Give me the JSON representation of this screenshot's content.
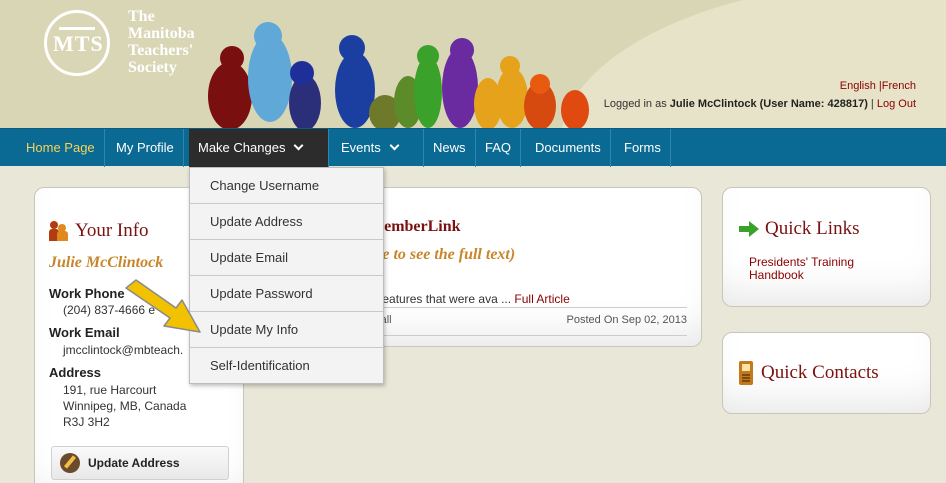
{
  "header": {
    "org_name_lines": [
      "The",
      "Manitoba",
      "Teachers'",
      "Society"
    ],
    "logo_letters": "MTS",
    "lang_english": "English",
    "lang_sep": " |",
    "lang_french": "French",
    "login_prefix": "Logged in as ",
    "login_user": "Julie McClintock (User Name: 428817)",
    "login_sep": " | ",
    "logout": "Log Out"
  },
  "nav": {
    "items": [
      {
        "label": "Home Page"
      },
      {
        "label": "My Profile"
      },
      {
        "label": "Make Changes"
      },
      {
        "label": "Events"
      },
      {
        "label": "News"
      },
      {
        "label": "FAQ"
      },
      {
        "label": "Documents"
      },
      {
        "label": "Forms"
      }
    ]
  },
  "dropdown": {
    "items": [
      "Change Username",
      "Update Address",
      "Update Email",
      "Update Password",
      "Update My Info",
      "Self-Identification"
    ]
  },
  "your_info": {
    "title": "Your Info",
    "name": "Julie McClintock",
    "work_phone_label": "Work Phone",
    "work_phone_value": "(204) 837-4666 e",
    "work_email_label": "Work Email",
    "work_email_value": "jmcclintock@mbteach.",
    "address_label": "Address",
    "address_line1": "191, rue Harcourt",
    "address_line2": "Winnipeg, MB, Canada",
    "address_line3": "R3J 3H2",
    "update_address_button": "Update Address"
  },
  "memberlink": {
    "title": "MemberLink",
    "subtitle": "itle to see the full text)",
    "text": "e features that were ava ... ",
    "full_article": "Full Article",
    "author": "dsall",
    "posted": "Posted On Sep 02, 2013"
  },
  "quick_links": {
    "title": "Quick Links",
    "link": "Presidents' Training Handbook"
  },
  "quick_contacts": {
    "title": "Quick Contacts"
  },
  "colors": {
    "nav_bg": "#0b6a93",
    "accent_red": "#7a1212",
    "accent_gold": "#c8862b",
    "home_link": "#f5d25a",
    "arrow_yellow": "#f2c200"
  }
}
